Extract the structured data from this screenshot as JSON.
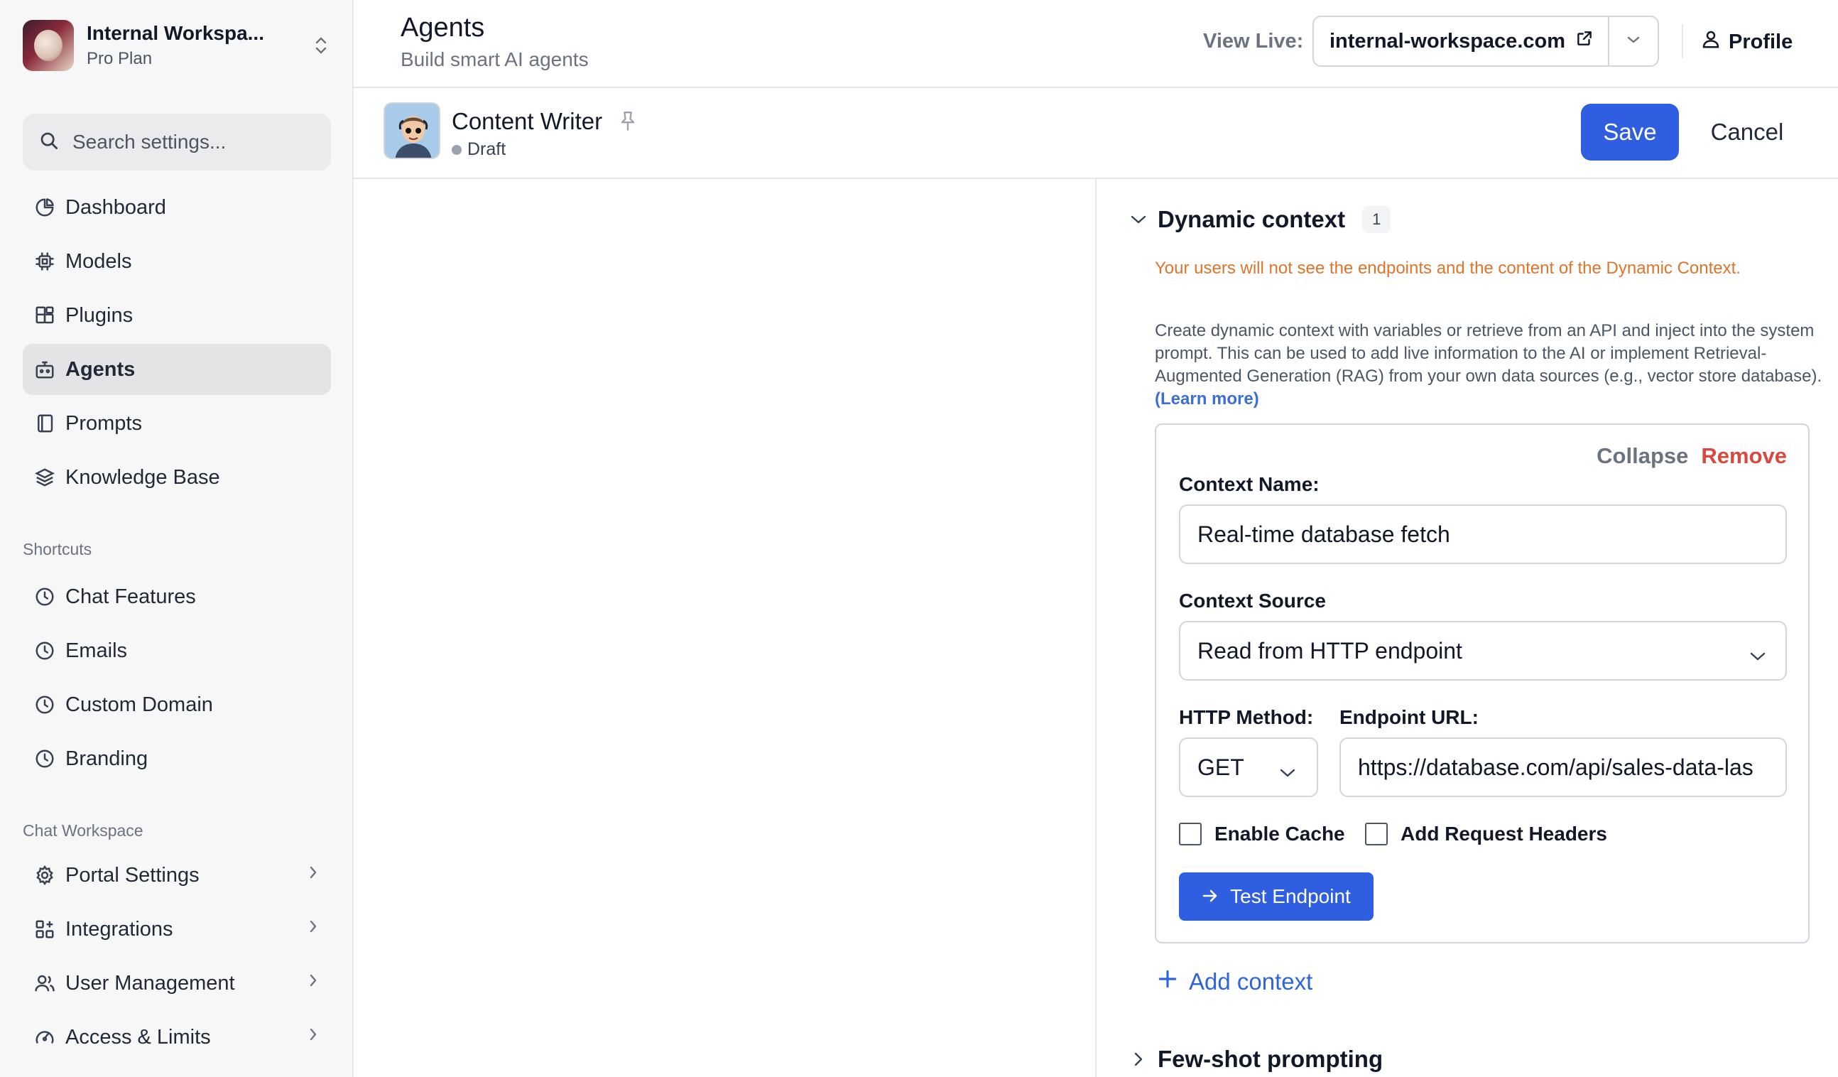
{
  "workspace": {
    "name": "Internal Workspa...",
    "plan": "Pro Plan"
  },
  "search": {
    "placeholder": "Search settings..."
  },
  "nav": {
    "main": [
      {
        "label": "Dashboard",
        "icon": "pie-chart-icon"
      },
      {
        "label": "Models",
        "icon": "chip-icon"
      },
      {
        "label": "Plugins",
        "icon": "blocks-icon"
      },
      {
        "label": "Agents",
        "icon": "bot-icon",
        "active": true
      },
      {
        "label": "Prompts",
        "icon": "notebook-icon"
      },
      {
        "label": "Knowledge Base",
        "icon": "database-icon"
      }
    ],
    "shortcuts_label": "Shortcuts",
    "shortcuts": [
      {
        "label": "Chat Features",
        "icon": "clock-icon"
      },
      {
        "label": "Emails",
        "icon": "clock-icon"
      },
      {
        "label": "Custom Domain",
        "icon": "clock-icon"
      },
      {
        "label": "Branding",
        "icon": "clock-icon"
      }
    ],
    "workspace_label": "Chat Workspace",
    "workspace_items": [
      {
        "label": "Portal Settings",
        "icon": "gear-icon"
      },
      {
        "label": "Integrations",
        "icon": "apps-icon"
      },
      {
        "label": "User Management",
        "icon": "users-icon"
      },
      {
        "label": "Access & Limits",
        "icon": "gauge-icon"
      }
    ]
  },
  "header": {
    "title": "Agents",
    "subtitle": "Build smart AI agents",
    "view_live_label": "View Live:",
    "view_live_url": "internal-workspace.com",
    "profile_label": "Profile"
  },
  "agent": {
    "name": "Content Writer",
    "status": "Draft",
    "save_label": "Save",
    "cancel_label": "Cancel"
  },
  "dynamic_context": {
    "title": "Dynamic context",
    "count": "1",
    "warning": "Your users will not see the endpoints and the content of the Dynamic Context.",
    "description": "Create dynamic context with variables or retrieve from an API and inject into the system prompt. This can be used to add live information to the AI or implement Retrieval-Augmented Generation (RAG) from your own data sources (e.g., vector store database).",
    "learn_more": "(Learn more)",
    "card": {
      "collapse_label": "Collapse",
      "remove_label": "Remove",
      "context_name_label": "Context Name:",
      "context_name_value": "Real-time database fetch",
      "context_source_label": "Context Source",
      "context_source_value": "Read from HTTP endpoint",
      "http_method_label": "HTTP Method:",
      "http_method_value": "GET",
      "endpoint_url_label": "Endpoint URL:",
      "endpoint_url_value": "https://database.com/api/sales-data-las",
      "enable_cache_label": "Enable Cache",
      "enable_cache_checked": false,
      "add_headers_label": "Add Request Headers",
      "add_headers_checked": false,
      "test_endpoint_label": "Test Endpoint"
    },
    "add_context_label": "Add context"
  },
  "few_shot": {
    "title": "Few-shot prompting"
  },
  "colors": {
    "accent": "#2f5fe0",
    "warning": "#e0742a",
    "danger": "#d9473e",
    "link": "#3b6fd8"
  }
}
